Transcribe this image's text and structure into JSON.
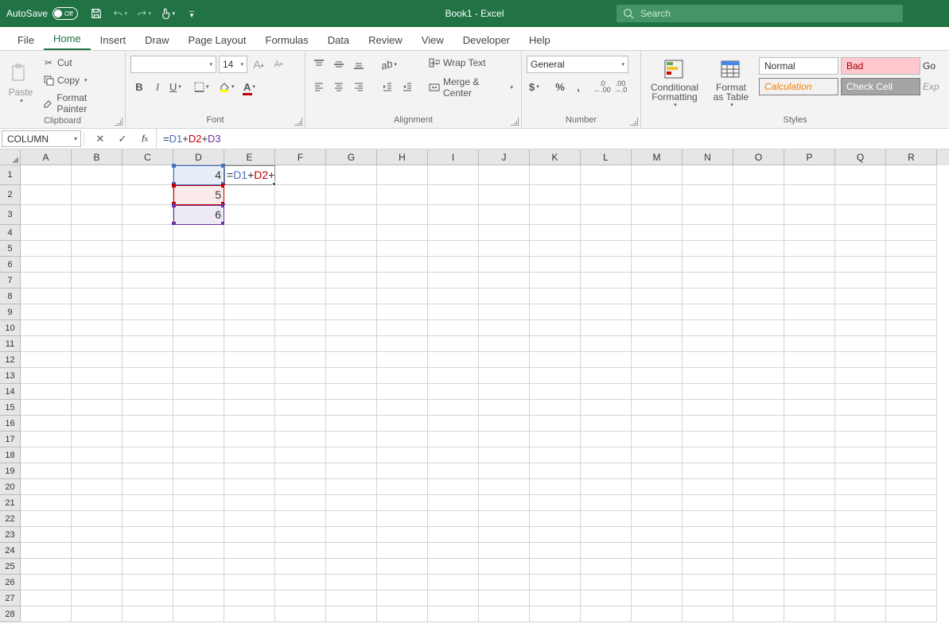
{
  "title_bar": {
    "autosave_label": "AutoSave",
    "autosave_state": "Off",
    "doc_title": "Book1  -  Excel",
    "search_placeholder": "Search"
  },
  "tabs": [
    "File",
    "Home",
    "Insert",
    "Draw",
    "Page Layout",
    "Formulas",
    "Data",
    "Review",
    "View",
    "Developer",
    "Help"
  ],
  "active_tab": "Home",
  "ribbon": {
    "clipboard": {
      "paste": "Paste",
      "cut": "Cut",
      "copy": "Copy",
      "format_painter": "Format Painter",
      "label": "Clipboard"
    },
    "font": {
      "name": "",
      "size": "14",
      "label": "Font"
    },
    "alignment": {
      "wrap": "Wrap Text",
      "merge": "Merge & Center",
      "label": "Alignment"
    },
    "number": {
      "format": "General",
      "label": "Number"
    },
    "styles": {
      "conditional": "Conditional Formatting",
      "format_table": "Format as Table",
      "normal": "Normal",
      "bad": "Bad",
      "good": "Go",
      "calculation": "Calculation",
      "check_cell": "Check Cell",
      "exp": "Exp",
      "label": "Styles"
    }
  },
  "name_box": "COLUMN",
  "formula_bar": "= D1+ D2 + D3",
  "columns": [
    "A",
    "B",
    "C",
    "D",
    "E",
    "F",
    "G",
    "H",
    "I",
    "J",
    "K",
    "L",
    "M",
    "N",
    "O",
    "P",
    "Q",
    "R"
  ],
  "row_count": 28,
  "cells": {
    "D1": "4",
    "D2": "5",
    "D3": "6",
    "E1_formula_parts": {
      "eq": "= ",
      "r1": "D1",
      "p1": "+ ",
      "r2": "D2",
      "p2": " + ",
      "r3": "D3"
    }
  },
  "active_cell": "E1",
  "chart_data": null
}
